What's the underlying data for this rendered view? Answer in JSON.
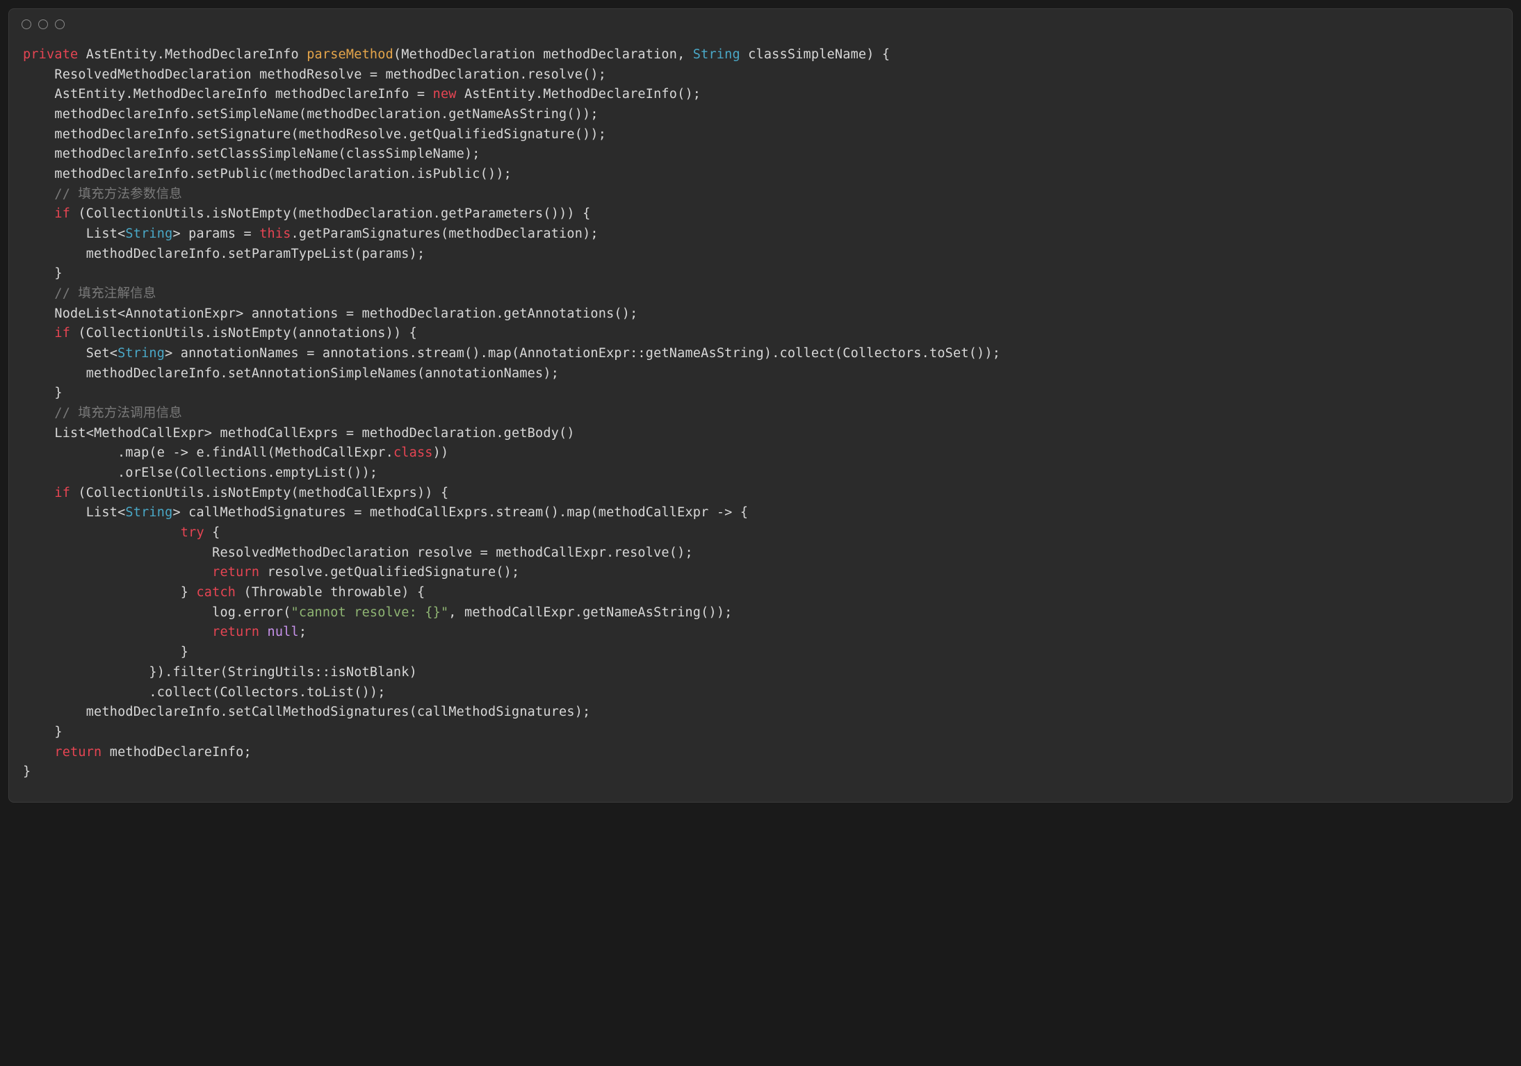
{
  "code": {
    "tokens": {
      "private": "private",
      "new": "new",
      "this": "this",
      "if": "if",
      "try": "try",
      "catch": "catch",
      "return": "return",
      "class": "class",
      "null": "null",
      "String": "String"
    },
    "identifiers": {
      "AstEntity": "AstEntity",
      "MethodDeclareInfo": "MethodDeclareInfo",
      "parseMethod": "parseMethod",
      "MethodDeclaration": "MethodDeclaration",
      "methodDeclaration": "methodDeclaration",
      "classSimpleName": "classSimpleName",
      "ResolvedMethodDeclaration": "ResolvedMethodDeclaration",
      "methodResolve": "methodResolve",
      "resolve": "resolve",
      "methodDeclareInfo": "methodDeclareInfo",
      "setSimpleName": "setSimpleName",
      "getNameAsString": "getNameAsString",
      "setSignature": "setSignature",
      "getQualifiedSignature": "getQualifiedSignature",
      "setClassSimpleName": "setClassSimpleName",
      "setPublic": "setPublic",
      "isPublic": "isPublic",
      "CollectionUtils": "CollectionUtils",
      "isNotEmpty": "isNotEmpty",
      "getParameters": "getParameters",
      "List": "List",
      "params": "params",
      "getParamSignatures": "getParamSignatures",
      "setParamTypeList": "setParamTypeList",
      "NodeList": "NodeList",
      "AnnotationExpr": "AnnotationExpr",
      "annotations": "annotations",
      "getAnnotations": "getAnnotations",
      "Set": "Set",
      "annotationNames": "annotationNames",
      "stream": "stream",
      "map": "map",
      "collect": "collect",
      "Collectors": "Collectors",
      "toSet": "toSet",
      "setAnnotationSimpleNames": "setAnnotationSimpleNames",
      "MethodCallExpr": "MethodCallExpr",
      "methodCallExprs": "methodCallExprs",
      "getBody": "getBody",
      "e": "e",
      "findAll": "findAll",
      "orElse": "orElse",
      "Collections": "Collections",
      "emptyList": "emptyList",
      "callMethodSignatures": "callMethodSignatures",
      "methodCallExpr": "methodCallExpr",
      "Throwable": "Throwable",
      "throwable": "throwable",
      "log": "log",
      "error": "error",
      "filter": "filter",
      "StringUtils": "StringUtils",
      "isNotBlank": "isNotBlank",
      "toList": "toList",
      "setCallMethodSignatures": "setCallMethodSignatures"
    },
    "comments": {
      "c1": "// 填充方法参数信息",
      "c2": "// 填充注解信息",
      "c3": "// 填充方法调用信息"
    },
    "strings": {
      "s1": "\"cannot resolve: {}\""
    }
  }
}
